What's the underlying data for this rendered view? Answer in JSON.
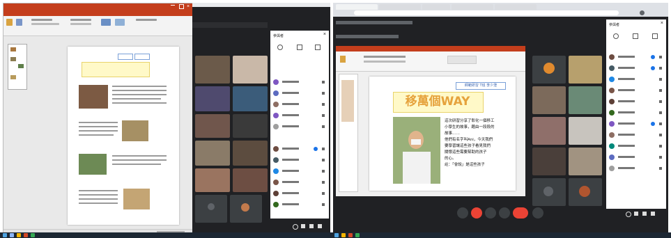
{
  "slide": {
    "header_label": "師範研習 T班 李少澄",
    "title": "移萬個WAY",
    "body_lines": [
      "這次研習分享了彰化一個移工",
      "小學生的故事，藉由一段段的",
      "故事……",
      "他們有名字叫Ani，今天我們",
      "要學習讓這些孩子看見我們",
      "關懷這些需要幫助的孩子",
      "的心。",
      "註：「會說」是這些孩子"
    ]
  },
  "meet": {
    "panel_title": "參與者"
  },
  "colors": {
    "powerpoint_red": "#c43e1c",
    "meet_dark": "#202124",
    "meet_blue": "#1a73e8",
    "end_call_red": "#ea4335",
    "title_gold": "#e6a23c",
    "taskbar": "#1c2733"
  }
}
